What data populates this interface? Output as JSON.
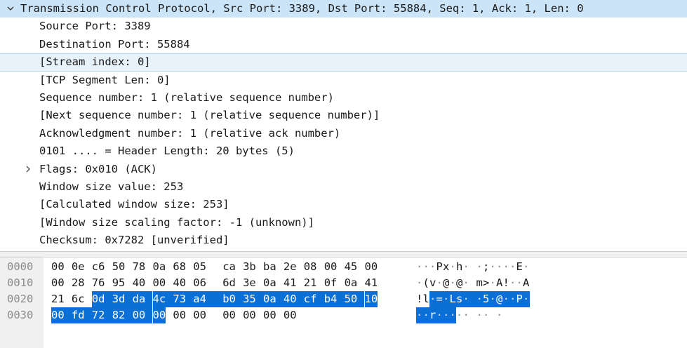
{
  "tree": {
    "header": "Transmission Control Protocol, Src Port: 3389, Dst Port: 55884, Seq: 1, Ack: 1, Len: 0",
    "fields": [
      {
        "text": "Source Port: 3389"
      },
      {
        "text": "Destination Port: 55884"
      },
      {
        "text": "[Stream index: 0]",
        "selected": true
      },
      {
        "text": "[TCP Segment Len: 0]"
      },
      {
        "text": "Sequence number: 1    (relative sequence number)"
      },
      {
        "text": "[Next sequence number: 1    (relative sequence number)]"
      },
      {
        "text": "Acknowledgment number: 1    (relative ack number)"
      },
      {
        "text": "0101 .... = Header Length: 20 bytes (5)"
      },
      {
        "text": "Flags: 0x010 (ACK)",
        "expandable": true
      },
      {
        "text": "Window size value: 253"
      },
      {
        "text": "[Calculated window size: 253]"
      },
      {
        "text": "[Window size scaling factor: -1 (unknown)]"
      },
      {
        "text": "Checksum: 0x7282 [unverified]"
      }
    ]
  },
  "hex_dump": {
    "rows": [
      {
        "offset": "0000",
        "bytes": [
          "00",
          "0e",
          "c6",
          "50",
          "78",
          "0a",
          "68",
          "05",
          "ca",
          "3b",
          "ba",
          "2e",
          "08",
          "00",
          "45",
          "00"
        ],
        "ascii": [
          ".",
          ".",
          ".",
          "P",
          "x",
          ".",
          "h",
          ".",
          ".",
          ";",
          ".",
          ".",
          ".",
          ".",
          "E",
          "."
        ]
      },
      {
        "offset": "0010",
        "bytes": [
          "00",
          "28",
          "76",
          "95",
          "40",
          "00",
          "40",
          "06",
          "6d",
          "3e",
          "0a",
          "41",
          "21",
          "0f",
          "0a",
          "41"
        ],
        "ascii": [
          ".",
          "(",
          "v",
          ".",
          "@",
          ".",
          "@",
          ".",
          "m",
          ">",
          ".",
          "A",
          "!",
          ".",
          ".",
          "A"
        ]
      },
      {
        "offset": "0020",
        "bytes": [
          "21",
          "6c",
          "0d",
          "3d",
          "da",
          "4c",
          "73",
          "a4",
          "b0",
          "35",
          "0a",
          "40",
          "cf",
          "b4",
          "50",
          "10"
        ],
        "ascii": [
          "!",
          "l",
          ".",
          "=",
          ".",
          "L",
          "s",
          ".",
          ".",
          "5",
          ".",
          "@",
          ".",
          ".",
          "P",
          "."
        ]
      },
      {
        "offset": "0030",
        "bytes": [
          "00",
          "fd",
          "72",
          "82",
          "00",
          "00",
          "00",
          "00",
          "00",
          "00",
          "00",
          "00"
        ],
        "ascii": [
          ".",
          ".",
          "r",
          ".",
          ".",
          ".",
          ".",
          ".",
          ".",
          ".",
          " ",
          "."
        ]
      }
    ],
    "highlight": {
      "start": 34,
      "end": 54
    },
    "highlight_color": "#0a6fd6"
  },
  "icons": {
    "expanded": "chevron-down-icon",
    "collapsed": "chevron-right-icon"
  }
}
